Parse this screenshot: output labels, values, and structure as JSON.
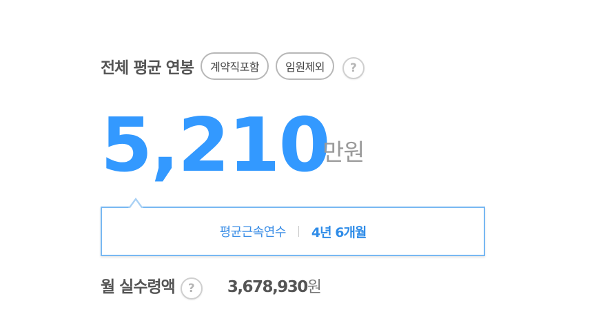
{
  "header": {
    "title": "전체 평균 연봉",
    "filters": [
      "계약직포함",
      "임원제외"
    ],
    "help_glyph": "?"
  },
  "salary": {
    "value": "5,210",
    "unit": "만원"
  },
  "tenure": {
    "label": "평균근속연수",
    "value": "4년 6개월"
  },
  "monthly": {
    "label": "월 실수령액",
    "help_glyph": "?",
    "amount": "3,678,930",
    "unit": "원"
  },
  "colors": {
    "accent": "#3399ff",
    "border_blue": "#78b8f2",
    "text_gray": "#555555",
    "unit_gray": "#9a9a9a"
  }
}
